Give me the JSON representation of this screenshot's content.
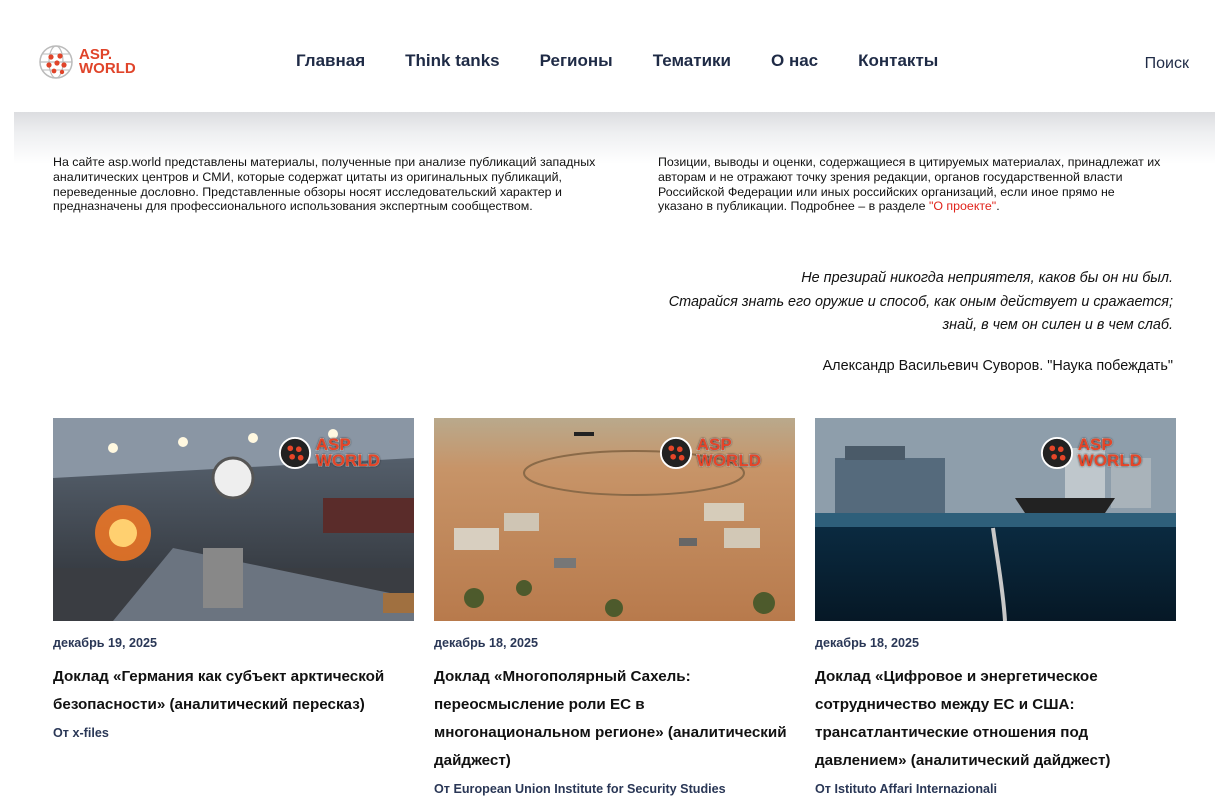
{
  "header": {
    "logo_line1": "ASP.",
    "logo_line2": "WORLD",
    "nav": [
      "Главная",
      "Think tanks",
      "Регионы",
      "Тематики",
      "О нас",
      "Контакты"
    ],
    "search_label": "Поиск"
  },
  "intro": {
    "left": "На сайте asp.world представлены материалы, полученные при анализе публикаций западных аналитических центров и СМИ, которые содержат цитаты из оригинальных публикаций, переведенные дословно. Представленные обзоры носят исследовательский характер и предназначены для профессионального использования экспертным сообществом.",
    "right_text": "Позиции, выводы и оценки, содержащиеся в цитируемых материалах, принадлежат их авторам и не отражают точку зрения редакции, органов государственной власти Российской Федерации или иных российских организаций, если иное прямо не указано в публикации. Подробнее – в разделе ",
    "right_link": "\"О проекте\"",
    "right_end": "."
  },
  "quote": {
    "line1": "Не презирай никогда неприятеля, каков бы он ни был.",
    "line2": "Старайся знать его оружие и способ, как оным действует и сражается;",
    "line3": "знай, в чем он силен и в чем слаб.",
    "author": "Александр Васильевич Суворов. \"Наука побеждать\""
  },
  "badge": {
    "line1": "ASP",
    "line2": "WORLD"
  },
  "cards": [
    {
      "date": "декабрь 19, 2025",
      "title": "Доклад «Германия как субъект арктической безопасности» (аналитический пересказ)",
      "author": "От x-files"
    },
    {
      "date": "декабрь 18, 2025",
      "title": "Доклад «Многополярный Сахель: переосмысление роли ЕС в многонациональном регионе» (аналитический дайджест)",
      "author": "От European Union Institute for Security Studies"
    },
    {
      "date": "декабрь 18, 2025",
      "title": "Доклад «Цифровое и энергетическое сотрудничество между ЕС и США: трансатлантические отношения под давлением» (аналитический дайджест)",
      "author": "От Istituto Affari Internazionali"
    }
  ],
  "colors": {
    "accent": "#e0442a",
    "nav": "#1f2b46",
    "link": "#e0221a"
  },
  "icons": {
    "logo": "globe-icon"
  }
}
